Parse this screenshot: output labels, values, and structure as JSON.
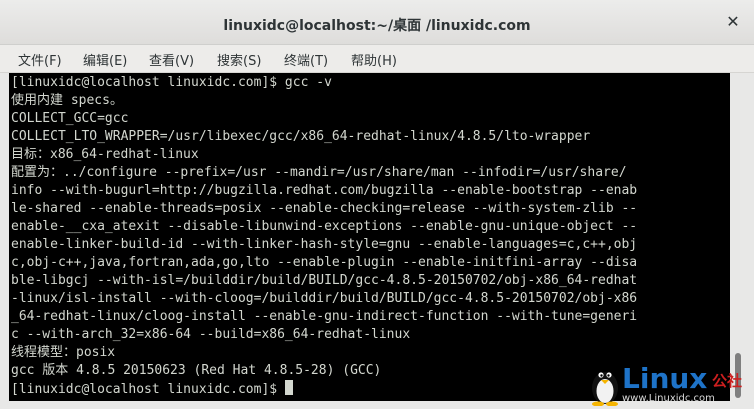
{
  "window": {
    "title": "linuxidc@localhost:~/桌面 /linuxidc.com",
    "close_glyph": "✕"
  },
  "menu": {
    "items": [
      {
        "label": "文件(F)"
      },
      {
        "label": "编辑(E)"
      },
      {
        "label": "查看(V)"
      },
      {
        "label": "搜索(S)"
      },
      {
        "label": "终端(T)"
      },
      {
        "label": "帮助(H)"
      }
    ]
  },
  "terminal": {
    "lines": [
      "[linuxidc@localhost linuxidc.com]$ gcc -v",
      "使用内建 specs。",
      "COLLECT_GCC=gcc",
      "COLLECT_LTO_WRAPPER=/usr/libexec/gcc/x86_64-redhat-linux/4.8.5/lto-wrapper",
      "目标：x86_64-redhat-linux",
      "配置为：../configure --prefix=/usr --mandir=/usr/share/man --infodir=/usr/share/",
      "info --with-bugurl=http://bugzilla.redhat.com/bugzilla --enable-bootstrap --enab",
      "le-shared --enable-threads=posix --enable-checking=release --with-system-zlib --",
      "enable-__cxa_atexit --disable-libunwind-exceptions --enable-gnu-unique-object --",
      "enable-linker-build-id --with-linker-hash-style=gnu --enable-languages=c,c++,obj",
      "c,obj-c++,java,fortran,ada,go,lto --enable-plugin --enable-initfini-array --disa",
      "ble-libgcj --with-isl=/builddir/build/BUILD/gcc-4.8.5-20150702/obj-x86_64-redhat",
      "-linux/isl-install --with-cloog=/builddir/build/BUILD/gcc-4.8.5-20150702/obj-x86",
      "_64-redhat-linux/cloog-install --enable-gnu-indirect-function --with-tune=generi",
      "c --with-arch_32=x86-64 --build=x86_64-redhat-linux",
      "线程模型：posix",
      "gcc 版本 4.8.5 20150623 (Red Hat 4.8.5-28) (GCC)",
      "[linuxidc@localhost linuxidc.com]$ "
    ]
  },
  "watermark": {
    "brand": "Linux",
    "brand_cn": "公社",
    "url": "www.Linuxidc.com"
  },
  "colors": {
    "terminal_bg": "#000000",
    "terminal_fg": "#d3d7cf",
    "brand_blue": "#1e73c8",
    "brand_red": "#cc1f1f"
  }
}
